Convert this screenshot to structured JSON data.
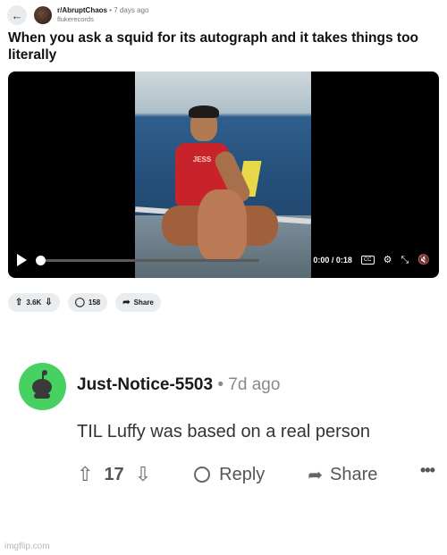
{
  "post": {
    "back_icon": "arrow-left-icon",
    "subreddit": "r/AbruptChaos",
    "separator": "•",
    "time": "7 days ago",
    "username": "flukerecords",
    "title": "When you ask a squid for its autograph and it takes things too literally"
  },
  "video": {
    "timecode": "0:00 / 0:18",
    "progress_fraction": 0.0,
    "shirt_text": "JESS",
    "cc_label": "CC",
    "icons": [
      "play-icon",
      "captions-icon",
      "settings-icon",
      "fullscreen-icon",
      "mute-icon"
    ]
  },
  "actions": {
    "votes": "3.6K",
    "comments": "158",
    "share": "Share"
  },
  "comment": {
    "author": "Just-Notice-5503",
    "separator": "•",
    "age": "7d ago",
    "text": "TIL Luffy was based on a real person",
    "score": "17",
    "reply_label": "Reply",
    "share_label": "Share",
    "more": "•••"
  },
  "watermark": "imgflip.com",
  "colors": {
    "avatar_green": "#46d160",
    "pill_bg": "#eaedef",
    "video_bg": "#000000"
  }
}
